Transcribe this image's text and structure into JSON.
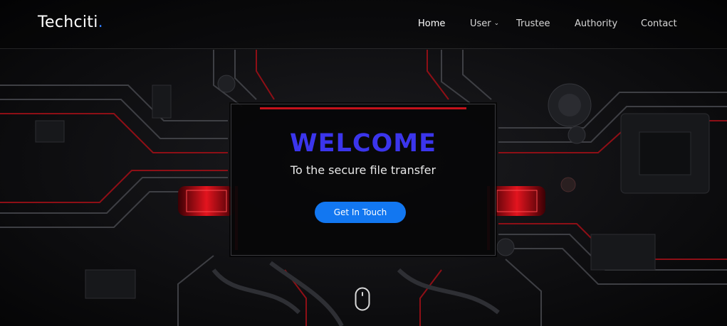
{
  "brand": {
    "name": "Techciti",
    "dot": ".",
    "dot_color": "#2f7cff"
  },
  "nav": {
    "items": [
      {
        "label": "Home",
        "active": true
      },
      {
        "label": "User",
        "has_dropdown": true
      },
      {
        "label": "Trustee"
      },
      {
        "label": "Authority"
      },
      {
        "label": "Contact"
      }
    ]
  },
  "hero": {
    "title": "WELCOME",
    "subtitle": "To the secure file transfer",
    "cta_label": "Get In Touch",
    "title_color": "#3b35ec",
    "cta_color": "#1277f1",
    "scroll_icon": "mouse-scroll-icon"
  },
  "colors": {
    "accent_red": "#c3121b",
    "background": "#0b0b0d"
  }
}
